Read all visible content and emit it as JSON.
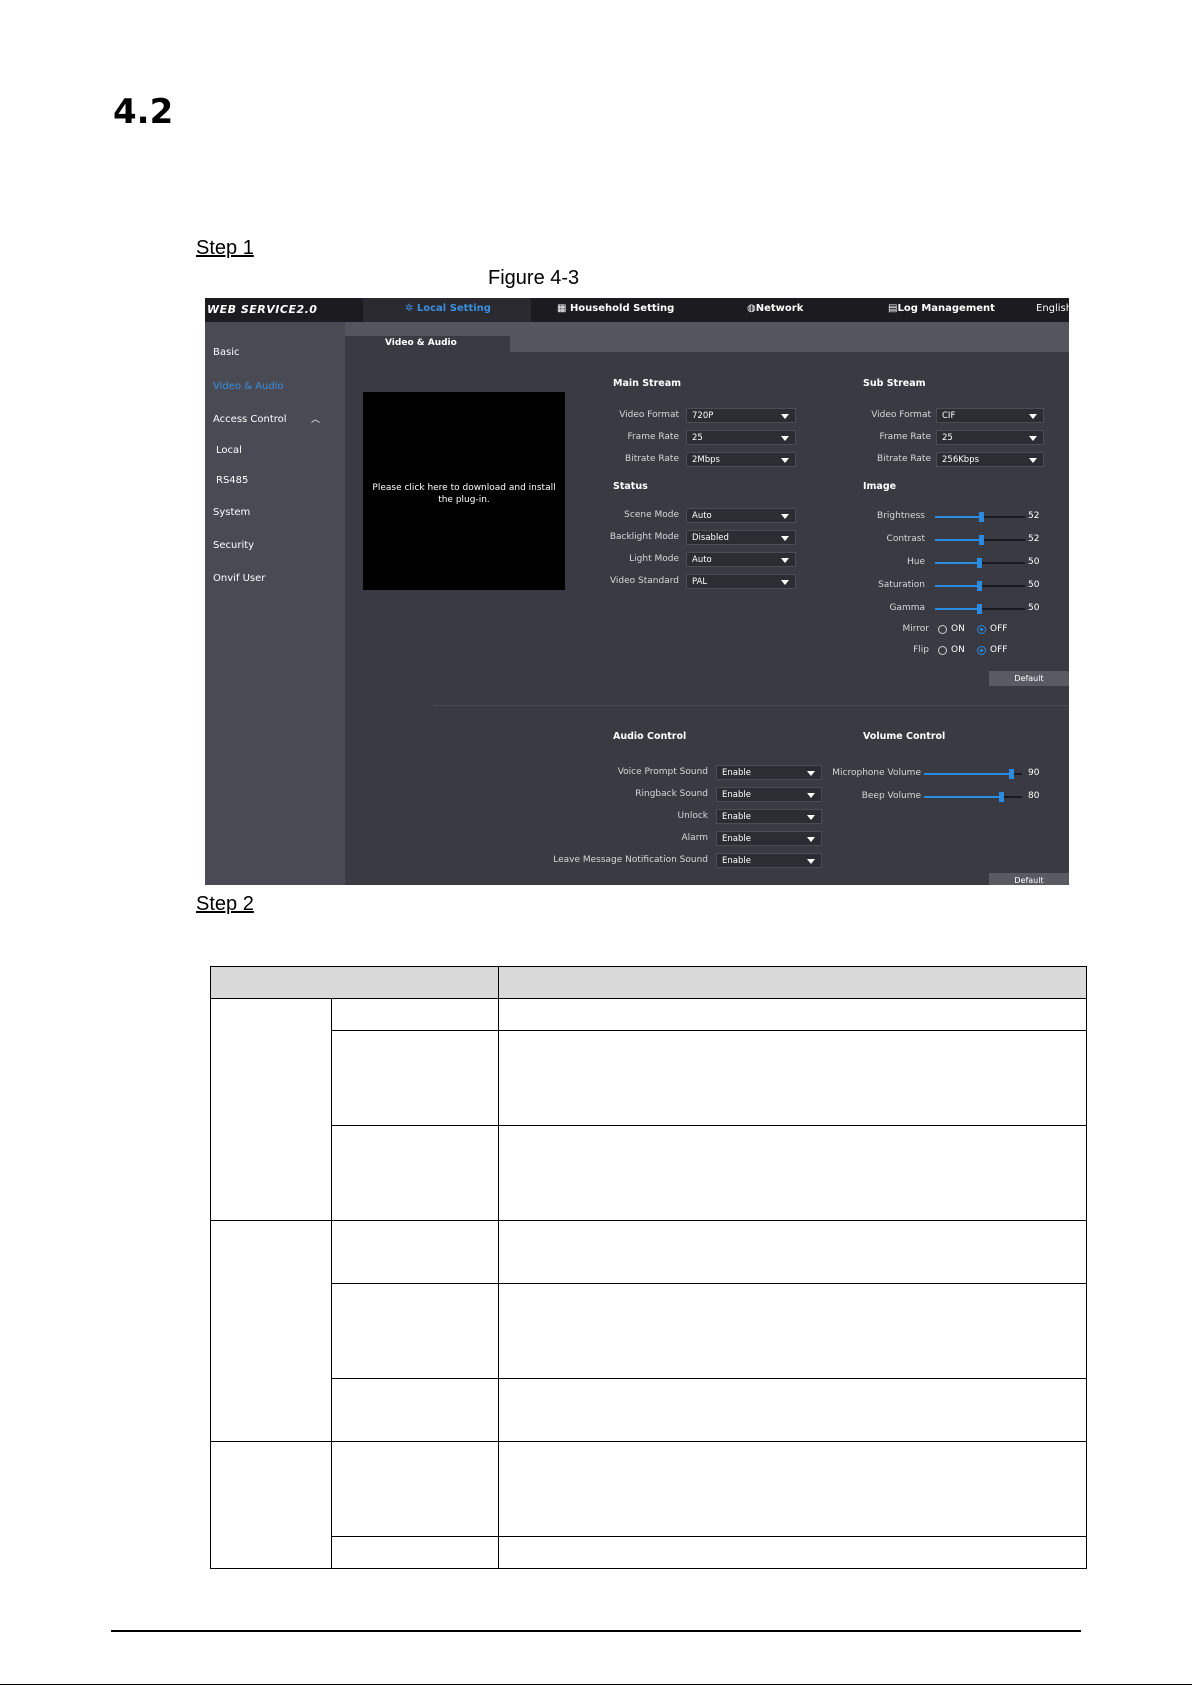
{
  "doc": {
    "section_number": "4.2",
    "step1": "Step 1",
    "figure_caption": "Figure 4-3",
    "step2": "Step 2"
  },
  "ui": {
    "brand": "WEB SERVICE2.0",
    "nav": {
      "local_setting": "Local Setting",
      "household_setting": "Household Setting",
      "network": "Network",
      "log_management": "Log Management",
      "language": "English"
    },
    "sidebar": [
      "Basic",
      "Video & Audio",
      "Access Control",
      "Local",
      "RS485",
      "System",
      "Security",
      "Onvif User"
    ],
    "tab": "Video & Audio",
    "video_placeholder": "Please click here to download and install the plug-in.",
    "main_stream": {
      "title": "Main Stream",
      "video_format_label": "Video Format",
      "video_format": "720P",
      "frame_rate_label": "Frame Rate",
      "frame_rate": "25",
      "bitrate_label": "Bitrate Rate",
      "bitrate": "2Mbps"
    },
    "sub_stream": {
      "title": "Sub Stream",
      "video_format_label": "Video Format",
      "video_format": "CIF",
      "frame_rate_label": "Frame Rate",
      "frame_rate": "25",
      "bitrate_label": "Bitrate Rate",
      "bitrate": "256Kbps"
    },
    "status": {
      "title": "Status",
      "scene_mode_label": "Scene Mode",
      "scene_mode": "Auto",
      "backlight_label": "Backlight Mode",
      "backlight": "Disabled",
      "light_mode_label": "Light Mode",
      "light_mode": "Auto",
      "video_standard_label": "Video Standard",
      "video_standard": "PAL"
    },
    "image": {
      "title": "Image",
      "brightness_label": "Brightness",
      "brightness": 52,
      "contrast_label": "Contrast",
      "contrast": 52,
      "hue_label": "Hue",
      "hue": 50,
      "saturation_label": "Saturation",
      "saturation": 50,
      "gamma_label": "Gamma",
      "gamma": 50,
      "mirror_label": "Mirror",
      "flip_label": "Flip",
      "on": "ON",
      "off": "OFF",
      "mirror_selected": "OFF",
      "flip_selected": "OFF"
    },
    "default_btn": "Default",
    "audio_control": {
      "title": "Audio Control",
      "voice_prompt_label": "Voice Prompt Sound",
      "voice_prompt": "Enable",
      "ringback_label": "Ringback Sound",
      "ringback": "Enable",
      "unlock_label": "Unlock",
      "unlock": "Enable",
      "alarm_label": "Alarm",
      "alarm": "Enable",
      "leave_msg_label": "Leave Message Notification Sound",
      "leave_msg": "Enable"
    },
    "volume_control": {
      "title": "Volume Control",
      "mic_label": "Microphone Volume",
      "mic": 90,
      "beep_label": "Beep Volume",
      "beep": 80
    },
    "colors": {
      "accent": "#2b8be0",
      "panel": "#3a3a42",
      "topbar": "#1c1c20"
    }
  }
}
